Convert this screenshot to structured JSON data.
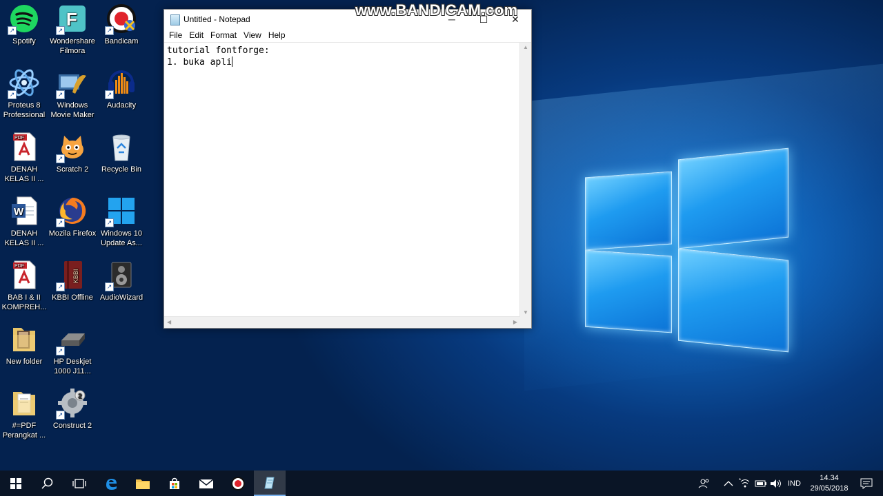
{
  "watermark": "www.BANDICAM.com",
  "desktop": {
    "icons": [
      {
        "label": "Spotify",
        "icon": "spotify-icon"
      },
      {
        "label": "Wondershare Filmora",
        "icon": "filmora-icon"
      },
      {
        "label": "Bandicam",
        "icon": "bandicam-icon"
      },
      {
        "label": "Proteus 8 Professional",
        "icon": "proteus-icon"
      },
      {
        "label": "Windows Movie Maker",
        "icon": "movie-maker-icon"
      },
      {
        "label": "Audacity",
        "icon": "audacity-icon"
      },
      {
        "label": "DENAH KELAS II ...",
        "icon": "pdf-file-icon"
      },
      {
        "label": "Scratch 2",
        "icon": "scratch-icon"
      },
      {
        "label": "Recycle Bin",
        "icon": "recycle-bin-icon"
      },
      {
        "label": "DENAH KELAS II ...",
        "icon": "word-file-icon"
      },
      {
        "label": "Mozila Firefox",
        "icon": "firefox-icon"
      },
      {
        "label": "Windows 10 Update As...",
        "icon": "windows-update-icon"
      },
      {
        "label": "BAB I & II KOMPREH...",
        "icon": "pdf-file-icon"
      },
      {
        "label": "KBBI Offline",
        "icon": "kbbi-icon"
      },
      {
        "label": "AudioWizard",
        "icon": "audiowizard-icon"
      },
      {
        "label": "New folder",
        "icon": "folder-icon"
      },
      {
        "label": "HP Deskjet 1000 J11...",
        "icon": "printer-icon"
      },
      {
        "label": "#=PDF Perangkat ...",
        "icon": "folder-icon"
      },
      {
        "label": "Construct 2",
        "icon": "construct-icon"
      }
    ]
  },
  "notepad": {
    "title": "Untitled - Notepad",
    "menu": [
      "File",
      "Edit",
      "Format",
      "View",
      "Help"
    ],
    "text_lines": [
      "tutorial fontforge:",
      "1. buka apli"
    ],
    "controls": {
      "minimize": "─",
      "maximize": "☐",
      "close": "✕"
    }
  },
  "taskbar": {
    "language": "IND",
    "time": "14.34",
    "date": "29/05/2018",
    "colors": {
      "bar": "#0a1526",
      "accent": "#7ab3f0"
    }
  }
}
